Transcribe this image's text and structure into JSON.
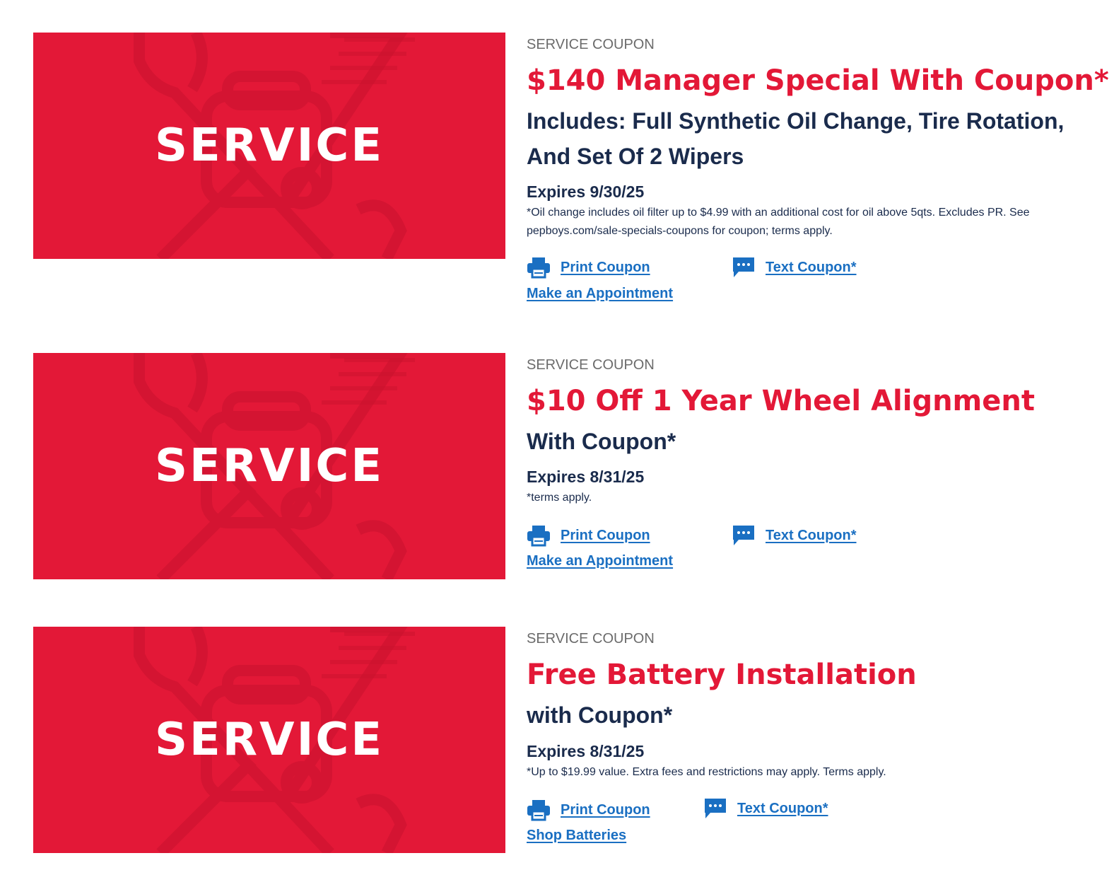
{
  "colors": {
    "brand_red": "#e31837",
    "navy": "#1a2b4c",
    "link_blue": "#1a6fc2",
    "eyebrow_gray": "#6b6b6b"
  },
  "coupons": [
    {
      "banner_text": "SERVICE",
      "eyebrow": "SERVICE COUPON",
      "title": "$140 Manager Special With Coupon*",
      "subtitle": "Includes: Full Synthetic Oil Change, Tire Rotation, And Set Of 2 Wipers",
      "expires": "Expires 9/30/25",
      "terms": "*Oil change includes oil filter up to $4.99 with an additional cost for oil above 5qts. Excludes PR. See pepboys.com/sale-specials-coupons for coupon; terms apply.",
      "print_label": "Print Coupon",
      "text_label": "Text Coupon*",
      "secondary_link": "Make an Appointment",
      "print_icon": "printer-icon",
      "text_icon": "chat-bubble-icon"
    },
    {
      "banner_text": "SERVICE",
      "eyebrow": "SERVICE COUPON",
      "title": "$10 Off 1 Year Wheel Alignment",
      "subtitle": "With Coupon*",
      "expires": "Expires 8/31/25",
      "terms": "*terms apply.",
      "print_label": "Print Coupon",
      "text_label": "Text Coupon*",
      "secondary_link": "Make an Appointment",
      "print_icon": "printer-icon",
      "text_icon": "chat-bubble-icon"
    },
    {
      "banner_text": "SERVICE",
      "eyebrow": "SERVICE COUPON",
      "title": "Free Battery Installation",
      "subtitle": "with Coupon*",
      "expires": "Expires 8/31/25",
      "terms": "*Up to $19.99 value. Extra fees and restrictions may apply. Terms apply.",
      "print_label": "Print Coupon",
      "text_label": "Text Coupon*",
      "secondary_link": "Shop Batteries",
      "print_icon": "printer-icon",
      "text_icon": "chat-bubble-icon"
    }
  ]
}
